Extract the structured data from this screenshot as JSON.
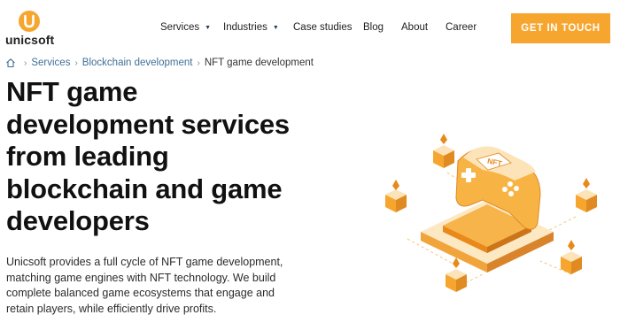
{
  "brand": {
    "name": "unicsoft",
    "logo_letter": "U"
  },
  "nav": {
    "items": [
      {
        "label": "Services",
        "has_dropdown": true
      },
      {
        "label": "Industries",
        "has_dropdown": true
      },
      {
        "label": "Case studies",
        "has_dropdown": false
      },
      {
        "label": "Blog",
        "has_dropdown": false
      },
      {
        "label": "About",
        "has_dropdown": false
      },
      {
        "label": "Career",
        "has_dropdown": false
      }
    ],
    "dropdown_caret": "▼",
    "cta_label": "GET IN TOUCH"
  },
  "breadcrumb": {
    "items": [
      "Services",
      "Blockchain development",
      "NFT game development"
    ],
    "separator": "›"
  },
  "hero": {
    "title": "NFT game development services from leading blockchain and game developers",
    "description": "Unicsoft provides a full cycle of NFT game development, matching game engines with NFT technology. We build complete balanced game ecosystems that engage and retain players, while efficiently drive profits."
  },
  "illustration": {
    "badge_text": "NFT"
  },
  "colors": {
    "accent": "#f6a62e",
    "accent_dark": "#e8891a",
    "link": "#3f7097",
    "text": "#111111"
  },
  "icons": [
    "logo-u-icon",
    "home-icon",
    "chevron-down-icon",
    "gamepad-icon",
    "crystal-icon"
  ]
}
